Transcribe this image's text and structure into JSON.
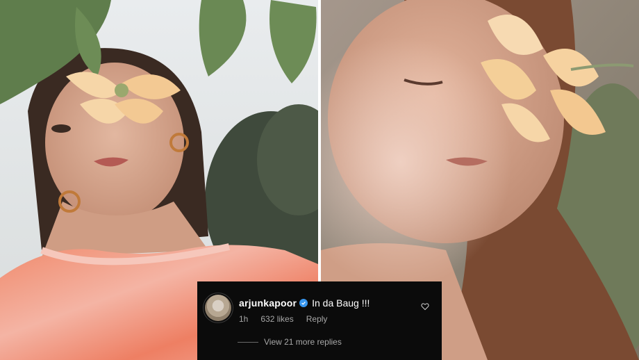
{
  "comment": {
    "avatar_icon": "profile-avatar",
    "username": "arjunkapoor",
    "verified_icon": "verified-badge-icon",
    "text": "In da Baug !!!",
    "time": "1h",
    "likes": "632 likes",
    "reply_label": "Reply",
    "like_icon": "heart-outline-icon",
    "view_replies": "View 21 more replies"
  },
  "colors": {
    "card_bg": "#0b0b0b",
    "meta_text": "#a8a8a8",
    "verified_blue": "#3897f0"
  }
}
